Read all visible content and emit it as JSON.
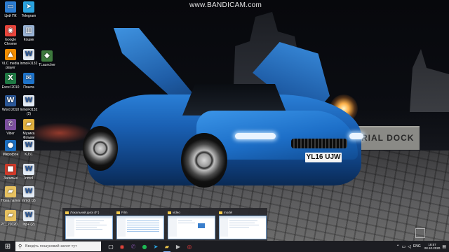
{
  "watermark": "www.BANDICAM.com",
  "desktop_icons": [
    {
      "label": "Цей ПК",
      "icon": "this-pc-icon",
      "color": "#2d7dd2",
      "glyph": "▭"
    },
    {
      "label": "Telegram",
      "icon": "telegram-icon",
      "color": "#2aa3e0",
      "glyph": "➤"
    },
    {
      "label": "Google Chrome",
      "icon": "chrome-icon",
      "color": "#e8453c",
      "glyph": "◉"
    },
    {
      "label": "Кошик",
      "icon": "recycle-bin-icon",
      "color": "#9ab4d6",
      "glyph": "▥"
    },
    {
      "label": "VLC media player",
      "icon": "vlc-icon",
      "color": "#f18c00",
      "glyph": "▲"
    },
    {
      "label": "lnmol-0132",
      "icon": "document-icon",
      "color": "#e4ecf6",
      "glyph": "W"
    },
    {
      "label": "Excel 2010",
      "icon": "excel-icon",
      "color": "#1f7a44",
      "glyph": "X"
    },
    {
      "label": "Пошта",
      "icon": "mail-icon",
      "color": "#1e73c9",
      "glyph": "✉"
    },
    {
      "label": "TLauncher",
      "icon": "tlauncher-icon",
      "color": "#3e7a3e",
      "glyph": "◆"
    },
    {
      "label": "Word 2010",
      "icon": "word-icon",
      "color": "#2b5797",
      "glyph": "W"
    },
    {
      "label": "lnmol-0132 (2)",
      "icon": "document-icon",
      "color": "#e4ecf6",
      "glyph": "W"
    },
    {
      "label": "Viber",
      "icon": "viber-icon",
      "color": "#7d4fa0",
      "glyph": "✆"
    },
    {
      "label": "Музика Фільми",
      "icon": "folder-icon",
      "color": "#e0b040",
      "glyph": "▰"
    },
    {
      "label": "Мікрофон",
      "icon": "microphone-icon",
      "color": "#1b6fc3",
      "glyph": "●"
    },
    {
      "label": "KJ31",
      "icon": "document-icon",
      "color": "#e4ecf6",
      "glyph": "W"
    },
    {
      "label": "Загальні",
      "icon": "app-red-icon",
      "color": "#d23a2a",
      "glyph": "■"
    },
    {
      "label": "lnmol",
      "icon": "document-icon",
      "color": "#e4ecf6",
      "glyph": "W"
    },
    {
      "label": "Нова папка",
      "icon": "folder-icon",
      "color": "#e7c160",
      "glyph": "▰"
    },
    {
      "label": "lnmol (2)",
      "icon": "document-icon",
      "color": "#e4ecf6",
      "glyph": "W"
    },
    {
      "label": "PC_21020...",
      "icon": "folder-icon",
      "color": "#e7c160",
      "glyph": "▰"
    },
    {
      "label": "lnp+ (2)",
      "icon": "document-icon",
      "color": "#e4ecf6",
      "glyph": "W"
    }
  ],
  "previews": [
    {
      "title": "Локальний диск (F:)"
    },
    {
      "title": "Film"
    },
    {
      "title": "video"
    },
    {
      "title": "model"
    }
  ],
  "taskbar": {
    "search_placeholder": "Введіть пошуковий запит тут",
    "language": "ENG",
    "time": "18:57",
    "date": "28.10.2020"
  },
  "wallpaper": {
    "dock_sign": "ERIAL DOCK",
    "plate": "YL16 UJW"
  }
}
